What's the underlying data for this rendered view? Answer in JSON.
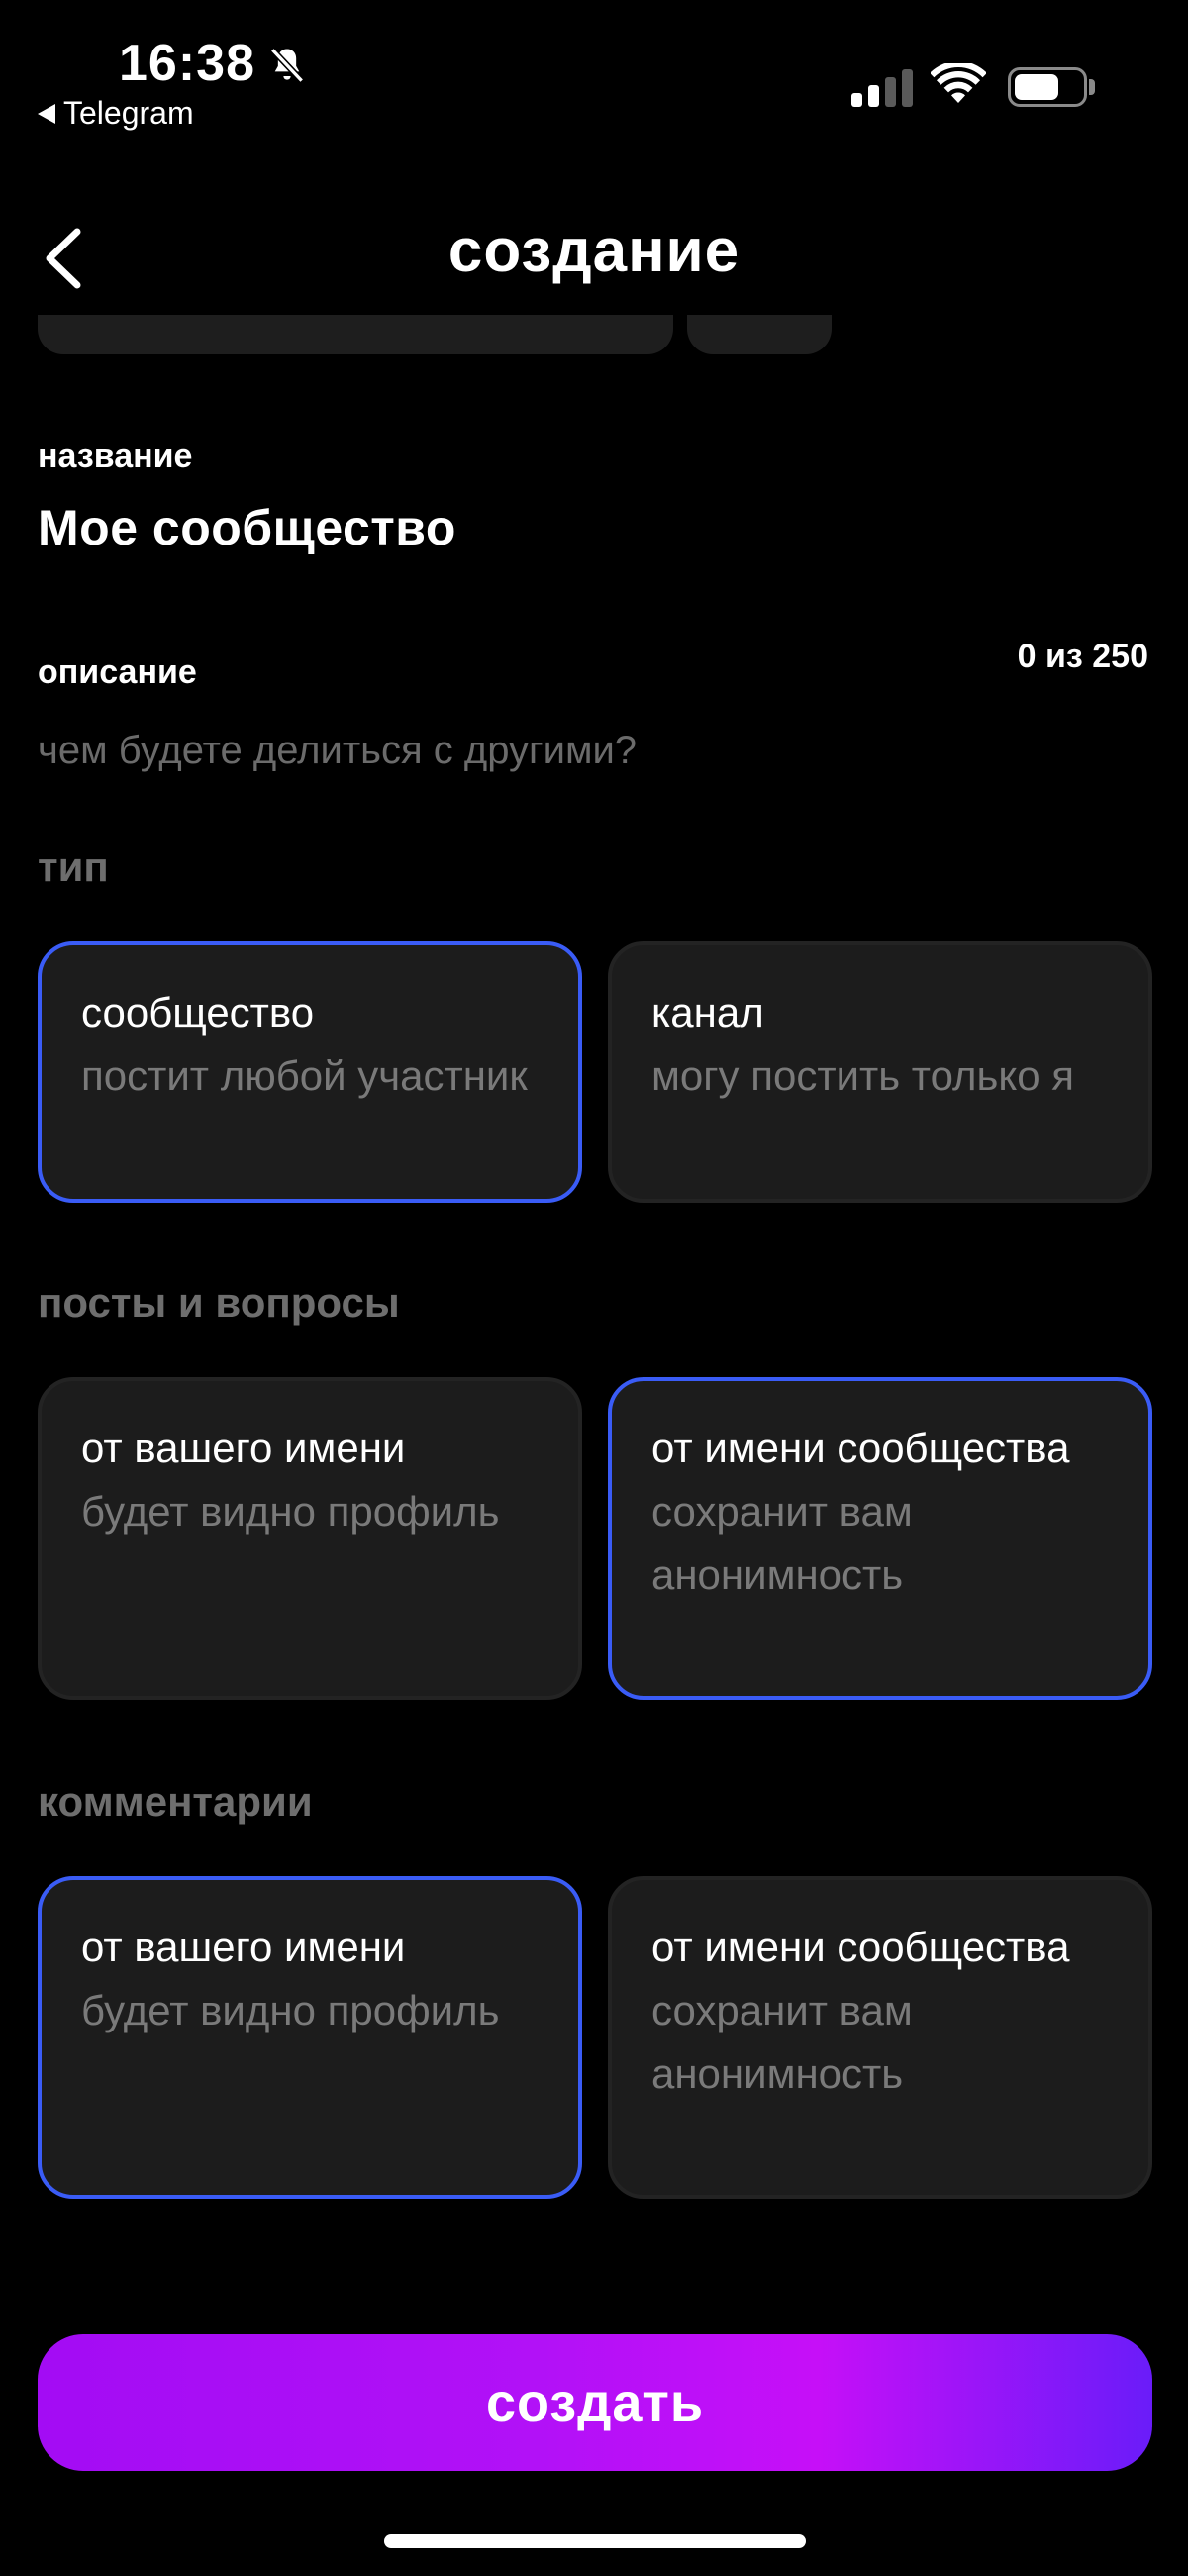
{
  "status_bar": {
    "time": "16:38",
    "back_app": "Telegram",
    "icons": [
      "bell-slash-icon",
      "cellular-signal-icon",
      "wifi-icon",
      "battery-icon"
    ],
    "battery_level": 0.6
  },
  "header": {
    "title": "создание",
    "back_icon": "chevron-left-icon"
  },
  "form": {
    "name_label": "название",
    "name_value": "Мое сообщество",
    "description_label": "описание",
    "description_counter": "0 из 250",
    "description_placeholder": "чем будете делиться с другими?"
  },
  "sections": {
    "type": {
      "title": "тип",
      "options": [
        {
          "title": "сообщество",
          "desc": "постит любой участник",
          "selected": true
        },
        {
          "title": "канал",
          "desc": "могу постить только я",
          "selected": false
        }
      ]
    },
    "posts": {
      "title": "посты и вопросы",
      "options": [
        {
          "title": "от вашего имени",
          "desc": "будет видно профиль",
          "selected": false
        },
        {
          "title": "от имени сообщества",
          "desc": "сохранит вам анонимность",
          "selected": true
        }
      ]
    },
    "comments": {
      "title": "комментарии",
      "options": [
        {
          "title": "от вашего имени",
          "desc": "будет видно профиль",
          "selected": true
        },
        {
          "title": "от имени сообщества",
          "desc": "сохранит вам анонимность",
          "selected": false
        }
      ]
    }
  },
  "actions": {
    "create_label": "создать"
  },
  "colors": {
    "background": "#000000",
    "card": "#1c1c1c",
    "selected_border": "#3a5cf6",
    "button_gradient_start": "#a30cf4",
    "button_gradient_end": "#6a1cf9"
  }
}
